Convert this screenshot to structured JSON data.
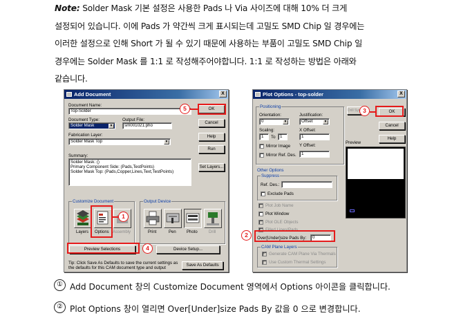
{
  "text": {
    "note_label": "Note:",
    "line1": "Solder Mask 기본 설정은 사용한 Pads 나 Via 사이즈에 대해 10% 더 크게",
    "line2": "설정되어 있습니다. 이에 Pads 가 약간씩 크게 표시되는데 고밀도 SMD Chip 일 경우에는",
    "line3": "이러한 설정으로 인해 Short 가 될 수 있기 때문에 사용하는 부품이 고밀도 SMD Chip 일",
    "line4": "경우에는 Solder Mask 를 1:1 로 작성해주어야합니다. 1:1 로 작성하는 방법은 아래와",
    "line5": "같습니다."
  },
  "add_document": {
    "title": "Add Document",
    "close": "X",
    "document_name_label": "Document Name:",
    "document_name_value": "Top-Solder",
    "document_type_label": "Document Type:",
    "document_type_value": "Solder Mask",
    "output_file_label": "Output File:",
    "output_file_value": "sm001021.pho",
    "fabrication_layer_label": "Fabrication Layer:",
    "fabrication_layer_value": "Solder Mask Top",
    "summary_label": "Summary:",
    "summary_lines": [
      "Solder Mask: ()",
      "Primary Component Side: (Pads,TestPoints)",
      "Solder Mask Top: (Pads,Copper,Lines,Text,TestPoints)"
    ],
    "ok": "OK",
    "cancel": "Cancel",
    "help": "Help",
    "run": "Run",
    "set_layers": "Set Layers...",
    "customize_label": "Customize Document",
    "customize_items": [
      "Layers",
      "Options",
      "Assembly"
    ],
    "output_device_label": "Output Device",
    "output_items": [
      "Print",
      "Pen",
      "Photo",
      "Drill"
    ],
    "preview_selections": "Preview Selections",
    "device_setup": "Device Setup...",
    "tip": "Tip: Click Save As Defaults to save the current settings as the defaults for this CAM document type and output",
    "save_defaults": "Save As Defaults"
  },
  "plot_options": {
    "title": "Plot Options - top-solder",
    "close": "X",
    "positioning_label": "Positioning",
    "orientation_label": "Orientation:",
    "orientation_value": "0",
    "justification_label": "Justification:",
    "justification_value": "Offset",
    "scaling_label": "Scaling:",
    "scale_a": "1",
    "to_label": "To",
    "scale_b": "1",
    "x_offset_label": "X Offset:",
    "x_offset_value": "1",
    "mirror_image": "Mirror Image",
    "y_offset_label": "Y Offset:",
    "mirror_ref": "Mirror Ref. Des.",
    "y_offset_value": "1",
    "drill_sym": "Drill Sym",
    "ok": "OK",
    "cancel": "Cancel",
    "help": "Help",
    "preview_label": "Preview",
    "other_options_label": "Other Options",
    "suppress_label": "Suppress",
    "ref_des_label": "Ref. Des.:",
    "exclude_pads": "Exclude Pads",
    "plot_job_name": "Plot Job Name",
    "plot_window": "Plot Window",
    "plot_ole": "Plot OLE Objects",
    "filled_lines": "Filled Lines/Pads",
    "oversize_label": "Over[Under]size Pads By:",
    "oversize_value": "0",
    "cam_plane_label": "CAM Plane Layers",
    "generate_cam": "Generate CAM Plane Via Thermals",
    "custom_thermal": "Use Custom Thermal Settings"
  },
  "callouts": [
    "1",
    "2",
    "3",
    "4",
    "5"
  ],
  "steps": [
    {
      "num": "①",
      "text": "Add Document 창의 Customize Document 영역에서 Options 아이콘을 클릭합니다."
    },
    {
      "num": "②",
      "text": "Plot Options 창이 열리면 Over[Under]size Pads By 값을 0 으로 변경합니다."
    }
  ],
  "colors": {
    "highlight": "#e51a1a",
    "title_bar": "#0a246a",
    "dialog": "#d4d0c8"
  }
}
